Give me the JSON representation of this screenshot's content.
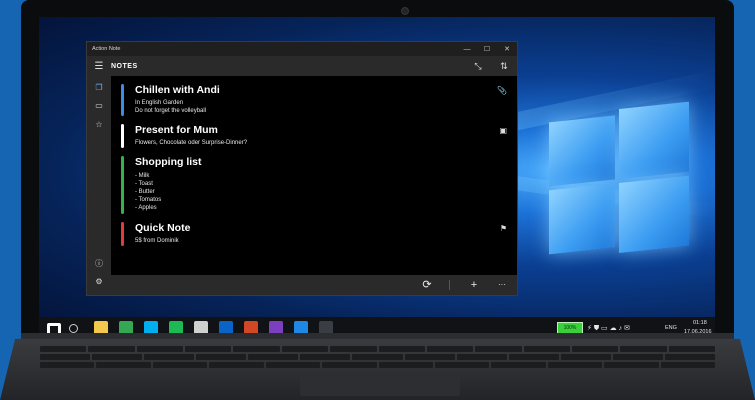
{
  "window": {
    "title": "Action Note",
    "buttons": {
      "minimize": "—",
      "maximize": "☐",
      "close": "✕"
    }
  },
  "header": {
    "menu_icon": "☰",
    "title": "NOTES",
    "collapse_icon": "⤡",
    "sort_icon": "⇅"
  },
  "sidebar": {
    "items": [
      {
        "name": "notes",
        "glyph": "❐"
      },
      {
        "name": "archive",
        "glyph": "▭"
      },
      {
        "name": "favorites",
        "glyph": "☆"
      },
      {
        "name": "info",
        "glyph": "ⓘ"
      },
      {
        "name": "settings",
        "glyph": "⚙"
      }
    ]
  },
  "notes": [
    {
      "title": "Chillen with Andi",
      "lines": [
        "In English Garden",
        "Do not forget the volleyball"
      ],
      "color": "#3a8ee6",
      "icon": "📎"
    },
    {
      "title": "Present for Mum",
      "lines": [
        "Flowers, Chocolate oder Surprise-Dinner?"
      ],
      "color": "#ffffff",
      "icon": "▣"
    },
    {
      "title": "Shopping list",
      "lines": [
        "- Milk",
        "- Toast",
        "- Butter",
        "- Tomatos",
        "- Apples"
      ],
      "color": "#35b24a",
      "icon": ""
    },
    {
      "title": "Quick Note",
      "lines": [
        "5$ from Dominik"
      ],
      "color": "#e23b3b",
      "icon": "⚑"
    }
  ],
  "bottombar": {
    "sync": "⟳",
    "add": "+",
    "more": "···"
  },
  "taskbar": {
    "battery": "100%",
    "lang": "ENG",
    "time": "01:18",
    "date": "17.06.2016",
    "apps": [
      {
        "name": "start",
        "color": "#ffffff"
      },
      {
        "name": "search",
        "color": "#cfcfcf"
      },
      {
        "name": "explorer",
        "color": "#f2c94c"
      },
      {
        "name": "chrome",
        "color": "#34a853"
      },
      {
        "name": "skype",
        "color": "#00aff0"
      },
      {
        "name": "spotify",
        "color": "#1db954"
      },
      {
        "name": "remote",
        "color": "#d0d0d0"
      },
      {
        "name": "outlook",
        "color": "#0a64c8"
      },
      {
        "name": "powerpoint",
        "color": "#d24726"
      },
      {
        "name": "visualstudio",
        "color": "#7b3fbf"
      },
      {
        "name": "vscode",
        "color": "#1e88e5"
      },
      {
        "name": "actionnote",
        "color": "#bbbbbb"
      }
    ]
  }
}
